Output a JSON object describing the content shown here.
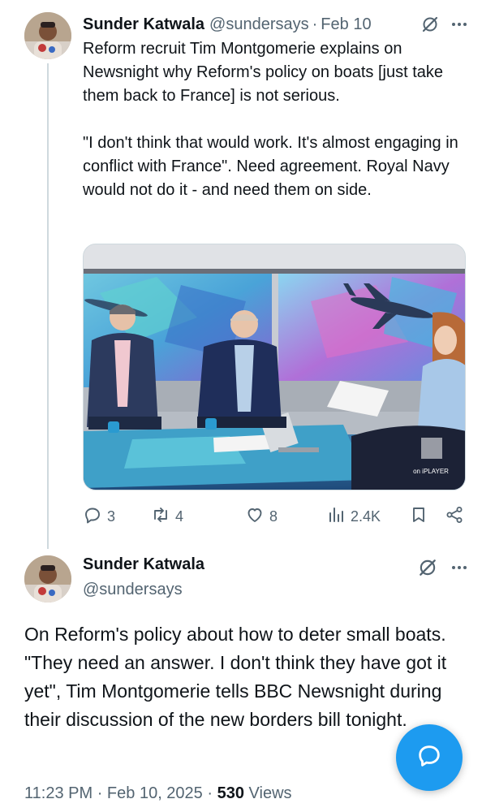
{
  "tweet1": {
    "author_name": "Sunder Katwala",
    "handle": "@sundersays",
    "separator": "·",
    "date": "Feb 10",
    "text": "Reform recruit Tim Montgomerie explains on Newsnight why Reform's policy on boats [just take them back to France] is not serious.\n\n\"I don't think that would work. It's almost engaging in conflict with France\".  Need agreement. Royal Navy would not do it - and need them on side.",
    "media": {
      "watermark": "on iPLAYER"
    },
    "actions": {
      "replies": "3",
      "reposts": "4",
      "likes": "8",
      "views": "2.4K"
    }
  },
  "tweet2": {
    "author_name": "Sunder Katwala",
    "handle": "@sundersays",
    "text": "On Reform's policy about how to deter small boats. \"They need an answer. I don't think they have got it yet\", Tim Montgomerie tells BBC Newsnight during their discussion of the new borders bill tonight.",
    "time": "11:23 PM",
    "separator": "·",
    "date": "Feb 10, 2025",
    "views_count": "530",
    "views_label": "Views"
  },
  "icons": {
    "grok": "grok-icon",
    "more": "more-icon",
    "reply": "reply-icon",
    "repost": "repost-icon",
    "like": "heart-icon",
    "views": "views-icon",
    "bookmark": "bookmark-icon",
    "share": "share-icon",
    "fab": "chat-bubble-icon"
  },
  "colors": {
    "accent": "#1d9bf0",
    "text": "#0f1419",
    "muted": "#536471",
    "line": "#cfd9de"
  }
}
